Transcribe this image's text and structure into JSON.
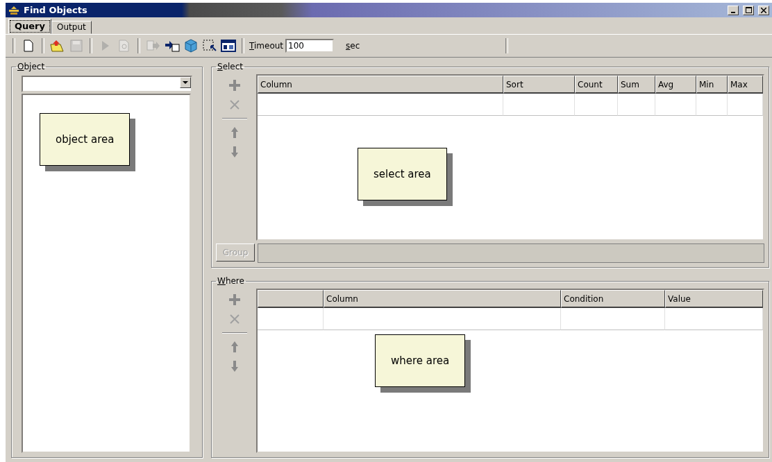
{
  "window": {
    "title": "Find Objects"
  },
  "tabs": [
    {
      "label": "Query",
      "selected": true
    },
    {
      "label": "Output",
      "selected": false
    }
  ],
  "toolbar": {
    "buttons": [
      {
        "disabled": false
      },
      {
        "disabled": false
      },
      {
        "disabled": true
      },
      {
        "disabled": true
      },
      {
        "disabled": true
      },
      {
        "disabled": true
      },
      {
        "disabled": false
      },
      {
        "disabled": false
      },
      {
        "disabled": false
      },
      {
        "disabled": false
      }
    ],
    "timeout_label": "Timeout",
    "timeout_value": "100",
    "timeout_unit": "sec"
  },
  "object_panel": {
    "title": "Object",
    "note": "object area"
  },
  "select_panel": {
    "title": "Select",
    "columns": [
      "Column",
      "Sort",
      "Count",
      "Sum",
      "Avg",
      "Min",
      "Max"
    ],
    "group_button": "Group",
    "note": "select area"
  },
  "where_panel": {
    "title": "Where",
    "columns": [
      "Column",
      "Condition",
      "Value"
    ],
    "note": "where area"
  }
}
